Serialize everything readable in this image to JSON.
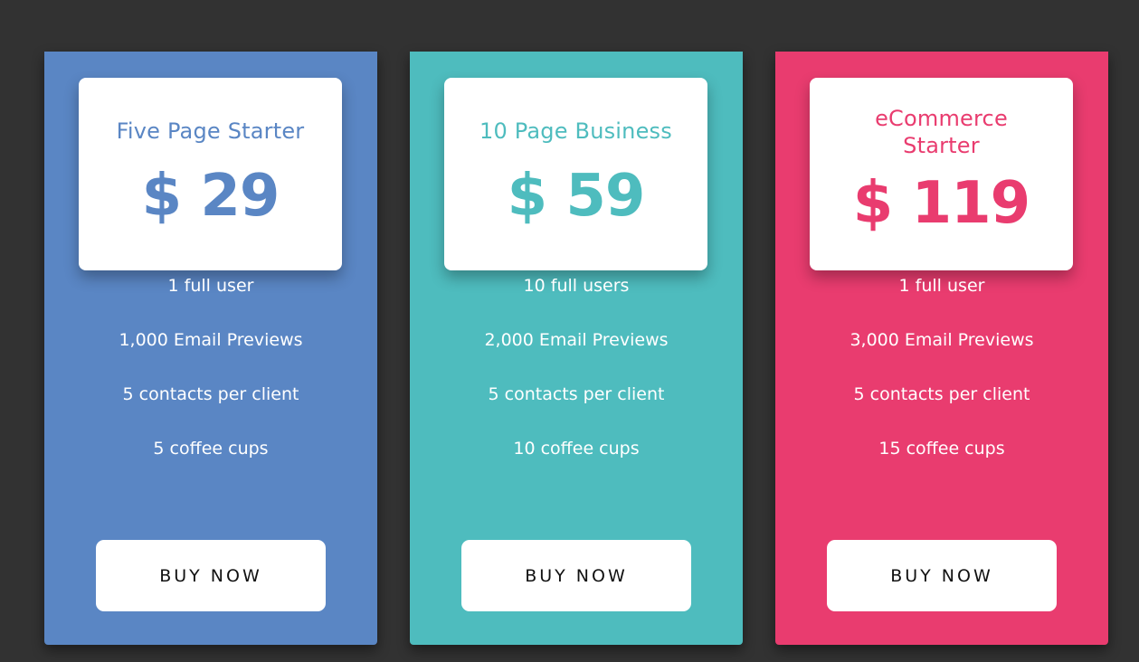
{
  "colors": {
    "background": "#323232",
    "blue": "#5a86c4",
    "teal": "#4ebcbe",
    "pink": "#e93c6f"
  },
  "plans": [
    {
      "name": "Five Page Starter",
      "price": "$ 29",
      "color": "#5a86c4",
      "features": [
        "1 full user",
        "1,000 Email Previews",
        "5 contacts per client",
        "5 coffee cups"
      ],
      "button_label": "BUY NOW"
    },
    {
      "name": "10 Page Business",
      "price": "$ 59",
      "color": "#4ebcbe",
      "features": [
        "10 full users",
        "2,000 Email Previews",
        "5 contacts per client",
        "10 coffee cups"
      ],
      "button_label": "BUY NOW"
    },
    {
      "name": "eCommerce Starter",
      "price": "$ 119",
      "color": "#e93c6f",
      "features": [
        "1 full user",
        "3,000 Email Previews",
        "5 contacts per client",
        "15 coffee cups"
      ],
      "button_label": "BUY NOW"
    }
  ]
}
